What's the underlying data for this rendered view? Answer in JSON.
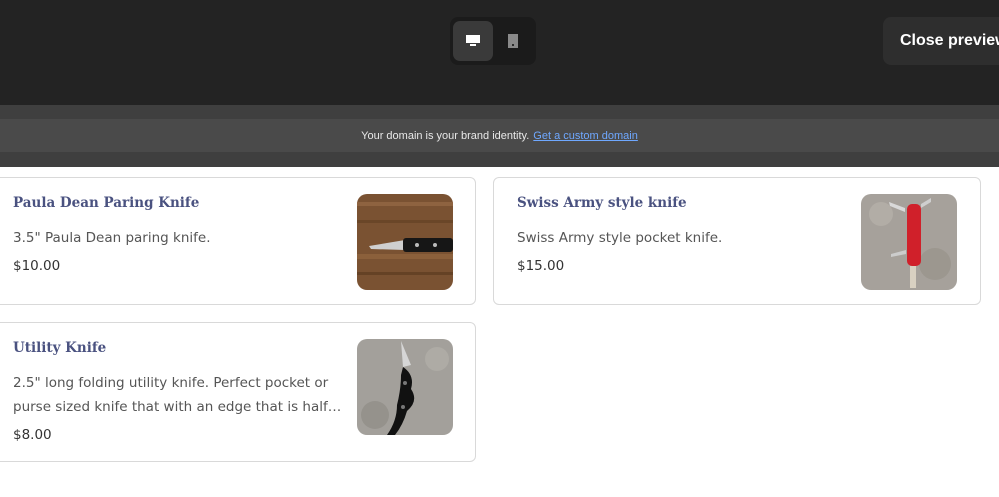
{
  "toolbar": {
    "desktop_icon": "desktop-icon",
    "mobile_icon": "mobile-icon",
    "close_label": "Close preview"
  },
  "banner": {
    "text": "Your domain is your brand identity.",
    "link": "Get a custom domain"
  },
  "products": [
    {
      "name": "Paula Dean Paring Knife",
      "description": "3.5\" Paula Dean paring knife.",
      "price": "$10.00"
    },
    {
      "name": "Swiss Army style knife",
      "description": "Swiss Army style pocket knife.",
      "price": "$15.00"
    },
    {
      "name": "Utility Knife",
      "description": "2.5\" long folding utility knife. Perfect pocket or purse sized knife that with an edge that is half…",
      "price": "$8.00"
    }
  ],
  "colors": {
    "title": "#4a5280",
    "link": "#6fa8ff",
    "topbar": "#232323"
  }
}
